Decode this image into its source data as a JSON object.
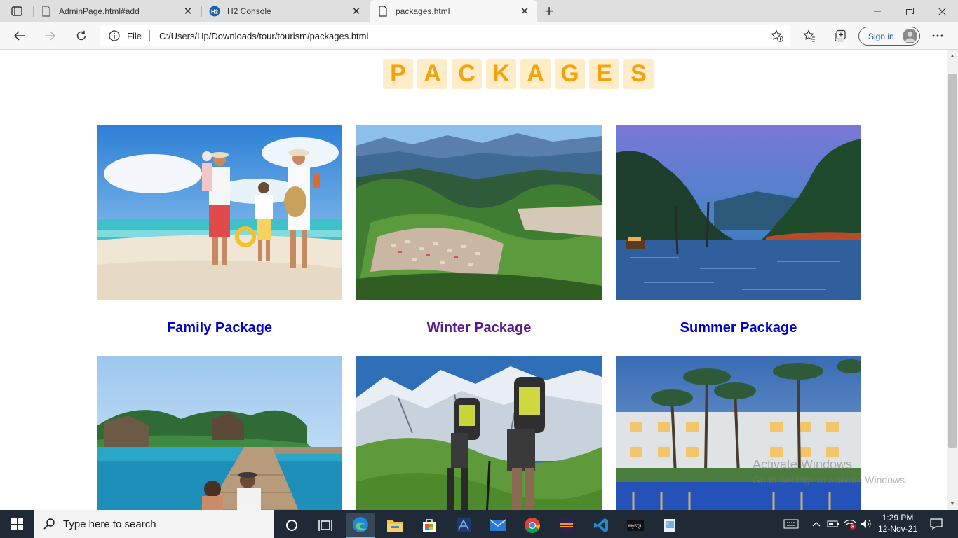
{
  "browser": {
    "tabs": [
      {
        "title": "AdminPage.html#add",
        "active": false
      },
      {
        "title": "H2 Console",
        "active": false
      },
      {
        "title": "packages.html",
        "active": true
      }
    ],
    "address": {
      "scheme": "File",
      "url": "C:/Users/Hp/Downloads/tour/tourism/packages.html"
    },
    "sign_in_label": "Sign in"
  },
  "page": {
    "heading_letters": [
      "P",
      "A",
      "C",
      "K",
      "A",
      "G",
      "E",
      "S"
    ],
    "packages": [
      {
        "name": "Family Package",
        "visited": false
      },
      {
        "name": "Winter Package",
        "visited": true
      },
      {
        "name": "Summer Package",
        "visited": false
      },
      {
        "name": "",
        "visited": false
      },
      {
        "name": "",
        "visited": false
      },
      {
        "name": "",
        "visited": false
      }
    ],
    "heading_color": "#f5a20c",
    "heading_bg": "#ffecc8",
    "link_color": "#0000cc",
    "visited_color": "#551a8b"
  },
  "watermark": {
    "line1": "Activate Windows",
    "line2": "Go to Settings to activate Windows."
  },
  "taskbar": {
    "search_placeholder": "Type here to search",
    "time": "1:29 PM",
    "date": "12-Nov-21",
    "apps": [
      "task-view-icon",
      "edge-icon",
      "file-explorer-icon",
      "store-icon",
      "eclipse-icon",
      "mail-icon",
      "chrome-icon",
      "eclipse-ide-icon",
      "vscode-icon",
      "mysql-icon",
      "paint-icon"
    ]
  }
}
